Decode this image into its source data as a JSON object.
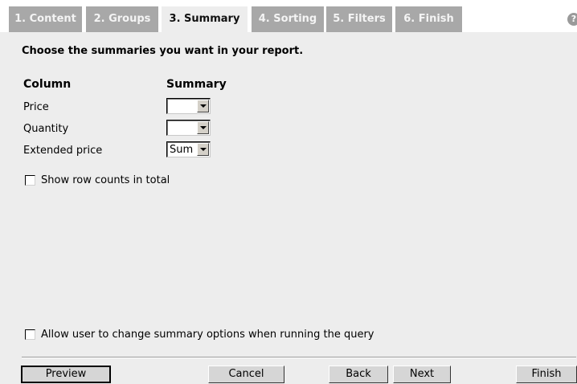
{
  "tabs": [
    {
      "label": "1. Content",
      "active": false
    },
    {
      "label": "2. Groups",
      "active": false
    },
    {
      "label": "3. Summary",
      "active": true
    },
    {
      "label": "4. Sorting",
      "active": false
    },
    {
      "label": "5. Filters",
      "active": false
    },
    {
      "label": "6. Finish",
      "active": false
    }
  ],
  "help_icon": {
    "glyph": "?"
  },
  "heading": "Choose the summaries you want in your report.",
  "table": {
    "column_header": "Column",
    "summary_header": "Summary",
    "rows": [
      {
        "label": "Price",
        "summary": ""
      },
      {
        "label": "Quantity",
        "summary": ""
      },
      {
        "label": "Extended price",
        "summary": "Sum"
      }
    ]
  },
  "options": {
    "row_counts_label": "Show row counts in total",
    "row_counts_checked": false,
    "allow_change_label": "Allow user to change summary options when running the query",
    "allow_change_checked": false
  },
  "buttons": {
    "preview": "Preview",
    "cancel": "Cancel",
    "back": "Back",
    "next": "Next",
    "finish": "Finish"
  }
}
